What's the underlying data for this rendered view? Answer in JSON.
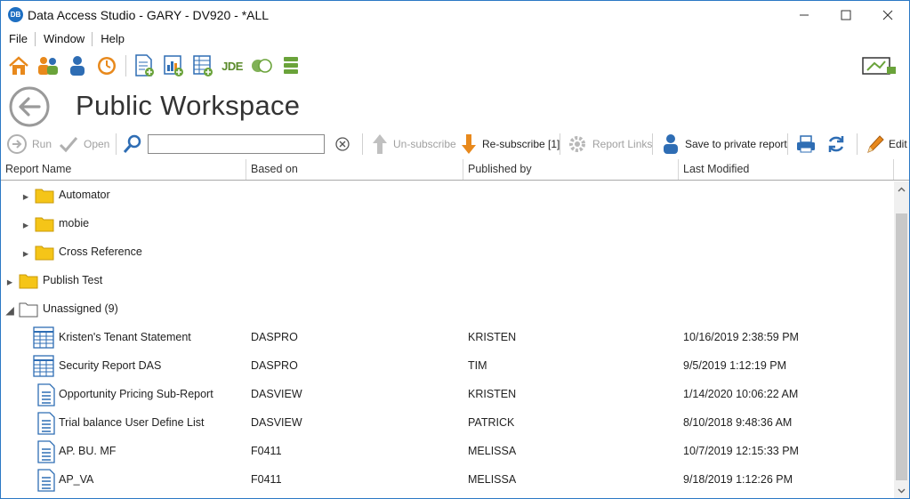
{
  "app": {
    "icon_text": "DB",
    "title": "Data Access Studio - GARY - DV920 - *ALL"
  },
  "menu": [
    "File",
    "Window",
    "Help"
  ],
  "toolbar": {
    "jde_label": "JDE"
  },
  "page": {
    "title": "Public Workspace"
  },
  "actions": {
    "run": "Run",
    "open": "Open",
    "search_value": "",
    "unsubscribe": "Un-subscribe",
    "resubscribe": "Re-subscribe [1]",
    "report_links": "Report Links",
    "save_private": "Save to private report",
    "edit": "Edit"
  },
  "columns": [
    "Report Name",
    "Based on",
    "Published by",
    "Last Modified"
  ],
  "tree": [
    {
      "type": "folder",
      "level": 1,
      "expanded": false,
      "name": "Automator"
    },
    {
      "type": "folder",
      "level": 1,
      "expanded": false,
      "name": "mobie"
    },
    {
      "type": "folder",
      "level": 1,
      "expanded": false,
      "name": "Cross Reference"
    },
    {
      "type": "folder",
      "level": 0,
      "expanded": false,
      "name": "Publish Test"
    },
    {
      "type": "folder",
      "level": 0,
      "expanded": true,
      "open": true,
      "name": "Unassigned (9)"
    }
  ],
  "reports": [
    {
      "icon": "grid-report",
      "name": "Kristen's Tenant Statement",
      "based_on": "DASPRO",
      "published_by": "KRISTEN",
      "last_modified": "10/16/2019 2:38:59 PM"
    },
    {
      "icon": "grid-report",
      "name": "Security Report DAS",
      "based_on": "DASPRO",
      "published_by": "TIM",
      "last_modified": "9/5/2019 1:12:19 PM"
    },
    {
      "icon": "list-report",
      "name": "Opportunity Pricing Sub-Report",
      "based_on": "DASVIEW",
      "published_by": "KRISTEN",
      "last_modified": "1/14/2020 10:06:22 AM"
    },
    {
      "icon": "list-report",
      "name": "Trial balance User Define List",
      "based_on": "DASVIEW",
      "published_by": "PATRICK",
      "last_modified": "8/10/2018 9:48:36 AM"
    },
    {
      "icon": "list-report",
      "name": "AP. BU. MF",
      "based_on": "F0411",
      "published_by": "MELISSA",
      "last_modified": "10/7/2019 12:15:33 PM"
    },
    {
      "icon": "list-report",
      "name": "AP_VA",
      "based_on": "F0411",
      "published_by": "MELISSA",
      "last_modified": "9/18/2019 1:12:26 PM"
    }
  ],
  "colors": {
    "accent": "#1e6fc2",
    "folder": "#f5c518",
    "home": "#e8891c",
    "disabled": "#a0a0a0"
  }
}
